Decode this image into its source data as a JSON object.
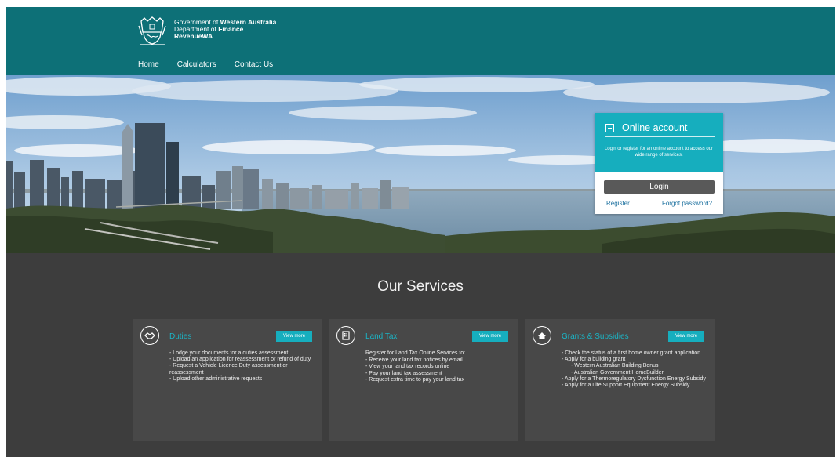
{
  "header": {
    "agency_line1_prefix": "Government of ",
    "agency_line1_bold": "Western Australia",
    "agency_line2_prefix": "Department of ",
    "agency_line2_bold": "Finance",
    "agency_line3": "RevenueWA",
    "crest_icon": "wa-government-crest-icon",
    "background": "#0d7077"
  },
  "nav": {
    "items": [
      {
        "label": "Home"
      },
      {
        "label": "Calculators"
      },
      {
        "label": "Contact Us"
      }
    ]
  },
  "online_account": {
    "title": "Online account",
    "icon": "login-door-icon",
    "description": "Login or register for an online account to access our wide range of services.",
    "login_label": "Login",
    "register_label": "Register",
    "forgot_label": "Forgot password?",
    "accent": "#16aebe"
  },
  "services": {
    "title": "Our Services",
    "cards": [
      {
        "title": "Duties",
        "icon": "handshake-icon",
        "button": "View more",
        "items": [
          {
            "text": "- Lodge your documents for a duties assessment"
          },
          {
            "text": "- Upload an application for reassessment or refund of duty"
          },
          {
            "text": "- Request a Vehicle Licence Duty assessment or reassessment"
          },
          {
            "text": "- Upload other administrative requests"
          }
        ]
      },
      {
        "title": "Land Tax",
        "icon": "building-icon",
        "button": "View more",
        "intro": "Register for Land Tax Online Services to:",
        "items": [
          {
            "text": "- Receive your land tax notices by email"
          },
          {
            "text": "- View your land tax records online"
          },
          {
            "text": "- Pay your land tax assessment"
          },
          {
            "text": "- Request extra time to pay your land tax"
          }
        ]
      },
      {
        "title": "Grants & Subsidies",
        "icon": "home-icon",
        "button": "View more",
        "items": [
          {
            "text": "- Check the status of a first home owner grant application"
          },
          {
            "text": "- Apply for a building grant"
          },
          {
            "text": "- Western Australian Building Bonus"
          },
          {
            "text": "- Australian Government HomeBuilder"
          },
          {
            "text": "- Apply for a Thermoregulatory Dysfunction Energy Subsidy"
          },
          {
            "text": "- Apply for a Life Support Equipment Energy Subsidy"
          }
        ]
      }
    ]
  }
}
